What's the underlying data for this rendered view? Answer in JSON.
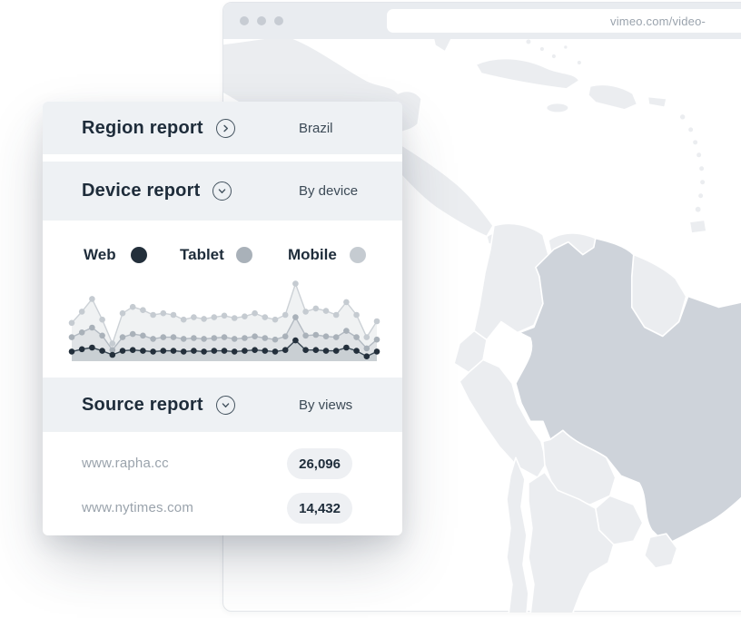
{
  "browser": {
    "url_text": "vimeo.com/video-"
  },
  "panel": {
    "sections": [
      {
        "title": "Region report",
        "value": "Brazil",
        "icon": "chevron-right"
      },
      {
        "title": "Device report",
        "value": "By device",
        "icon": "chevron-down"
      },
      {
        "title": "Source report",
        "value": "By views",
        "icon": "chevron-down"
      }
    ],
    "legend": [
      {
        "label": "Web",
        "color": "#232f3b"
      },
      {
        "label": "Tablet",
        "color": "#a9b1b9"
      },
      {
        "label": "Mobile",
        "color": "#c5cbd1"
      }
    ],
    "sources": [
      {
        "domain": "www.rapha.cc",
        "views": "26,096"
      },
      {
        "domain": "www.nytimes.com",
        "views": "14,432"
      }
    ]
  },
  "chart_data": {
    "type": "line",
    "x_axis": {
      "points": 31,
      "tick_labels_visible": false
    },
    "ylim": [
      0,
      100
    ],
    "grid": false,
    "legend_position": "top",
    "series": [
      {
        "name": "Mobile",
        "color": "#c5cbd1",
        "line_color": "#ccd1d6",
        "fill": "rgba(150,160,172,0.14)",
        "values": [
          48,
          62,
          78,
          52,
          22,
          60,
          68,
          64,
          58,
          60,
          58,
          52,
          55,
          53,
          55,
          57,
          54,
          56,
          60,
          55,
          52,
          58,
          97,
          62,
          66,
          63,
          58,
          74,
          58,
          30,
          50
        ]
      },
      {
        "name": "Tablet",
        "color": "#a9b1b9",
        "line_color": "#b3bac2",
        "fill": "rgba(140,150,162,0.16)",
        "values": [
          30,
          36,
          42,
          32,
          14,
          30,
          34,
          32,
          28,
          30,
          30,
          28,
          29,
          28,
          29,
          30,
          28,
          29,
          31,
          29,
          27,
          31,
          55,
          32,
          33,
          31,
          30,
          38,
          30,
          16,
          27
        ]
      },
      {
        "name": "Web",
        "color": "#232f3b",
        "line_color": "#3a4854",
        "fill": "rgba(100,115,130,0.18)",
        "values": [
          12,
          15,
          17,
          13,
          8,
          13,
          14,
          13,
          12,
          13,
          13,
          12,
          13,
          12,
          13,
          13,
          12,
          13,
          14,
          13,
          12,
          14,
          26,
          14,
          14,
          13,
          13,
          17,
          13,
          6,
          12
        ]
      }
    ]
  },
  "map": {
    "highlighted_region": "Brazil",
    "land_color": "#ebedf0",
    "highlight_color": "#ced3da",
    "border_color": "#ffffff",
    "ocean_color": "#ffffff"
  },
  "colors": {
    "header_bg": "#eef1f4",
    "title_text": "#1e2c3a",
    "value_text": "#3c4a56",
    "muted_text": "#9aa3ac",
    "badge_bg": "#eef0f3",
    "chrome_bg": "#e9ecf0",
    "chrome_dot": "#c7ccd3"
  }
}
